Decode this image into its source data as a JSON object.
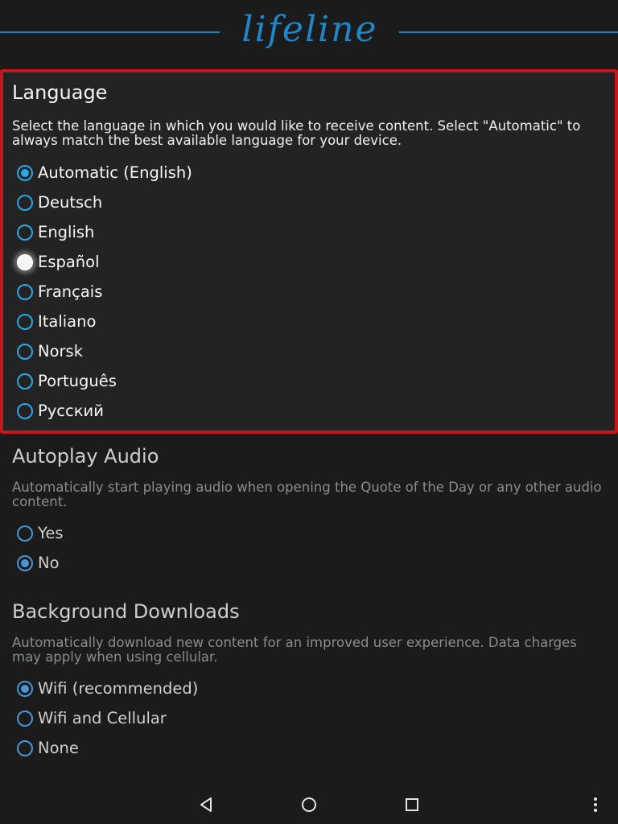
{
  "header": {
    "logo_text": "lifeline",
    "accent_color": "#1f86c8"
  },
  "language": {
    "title": "Language",
    "description": "Select the language in which you would like to receive content. Select \"Automatic\" to always match the best available language for your device.",
    "highlight_color": "#c8161d",
    "selected": "Automatic (English)",
    "pressed": "Español",
    "options": [
      {
        "label": "Automatic (English)"
      },
      {
        "label": "Deutsch"
      },
      {
        "label": "English"
      },
      {
        "label": "Español"
      },
      {
        "label": "Français"
      },
      {
        "label": "Italiano"
      },
      {
        "label": "Norsk"
      },
      {
        "label": "Português"
      },
      {
        "label": "Русский"
      }
    ]
  },
  "autoplay": {
    "title": "Autoplay Audio",
    "description": "Automatically start playing audio when opening the Quote of the Day or any other audio content.",
    "selected": "No",
    "options": [
      {
        "label": "Yes"
      },
      {
        "label": "No"
      }
    ]
  },
  "downloads": {
    "title": "Background Downloads",
    "description": "Automatically download new content for an improved user experience. Data charges may apply when using cellular.",
    "selected": "Wifi (recommended)",
    "options": [
      {
        "label": "Wifi (recommended)"
      },
      {
        "label": "Wifi and Cellular"
      },
      {
        "label": "None"
      }
    ]
  },
  "navbar": {
    "icons": [
      "back-icon",
      "home-icon",
      "recents-icon",
      "more-vertical-icon"
    ]
  }
}
